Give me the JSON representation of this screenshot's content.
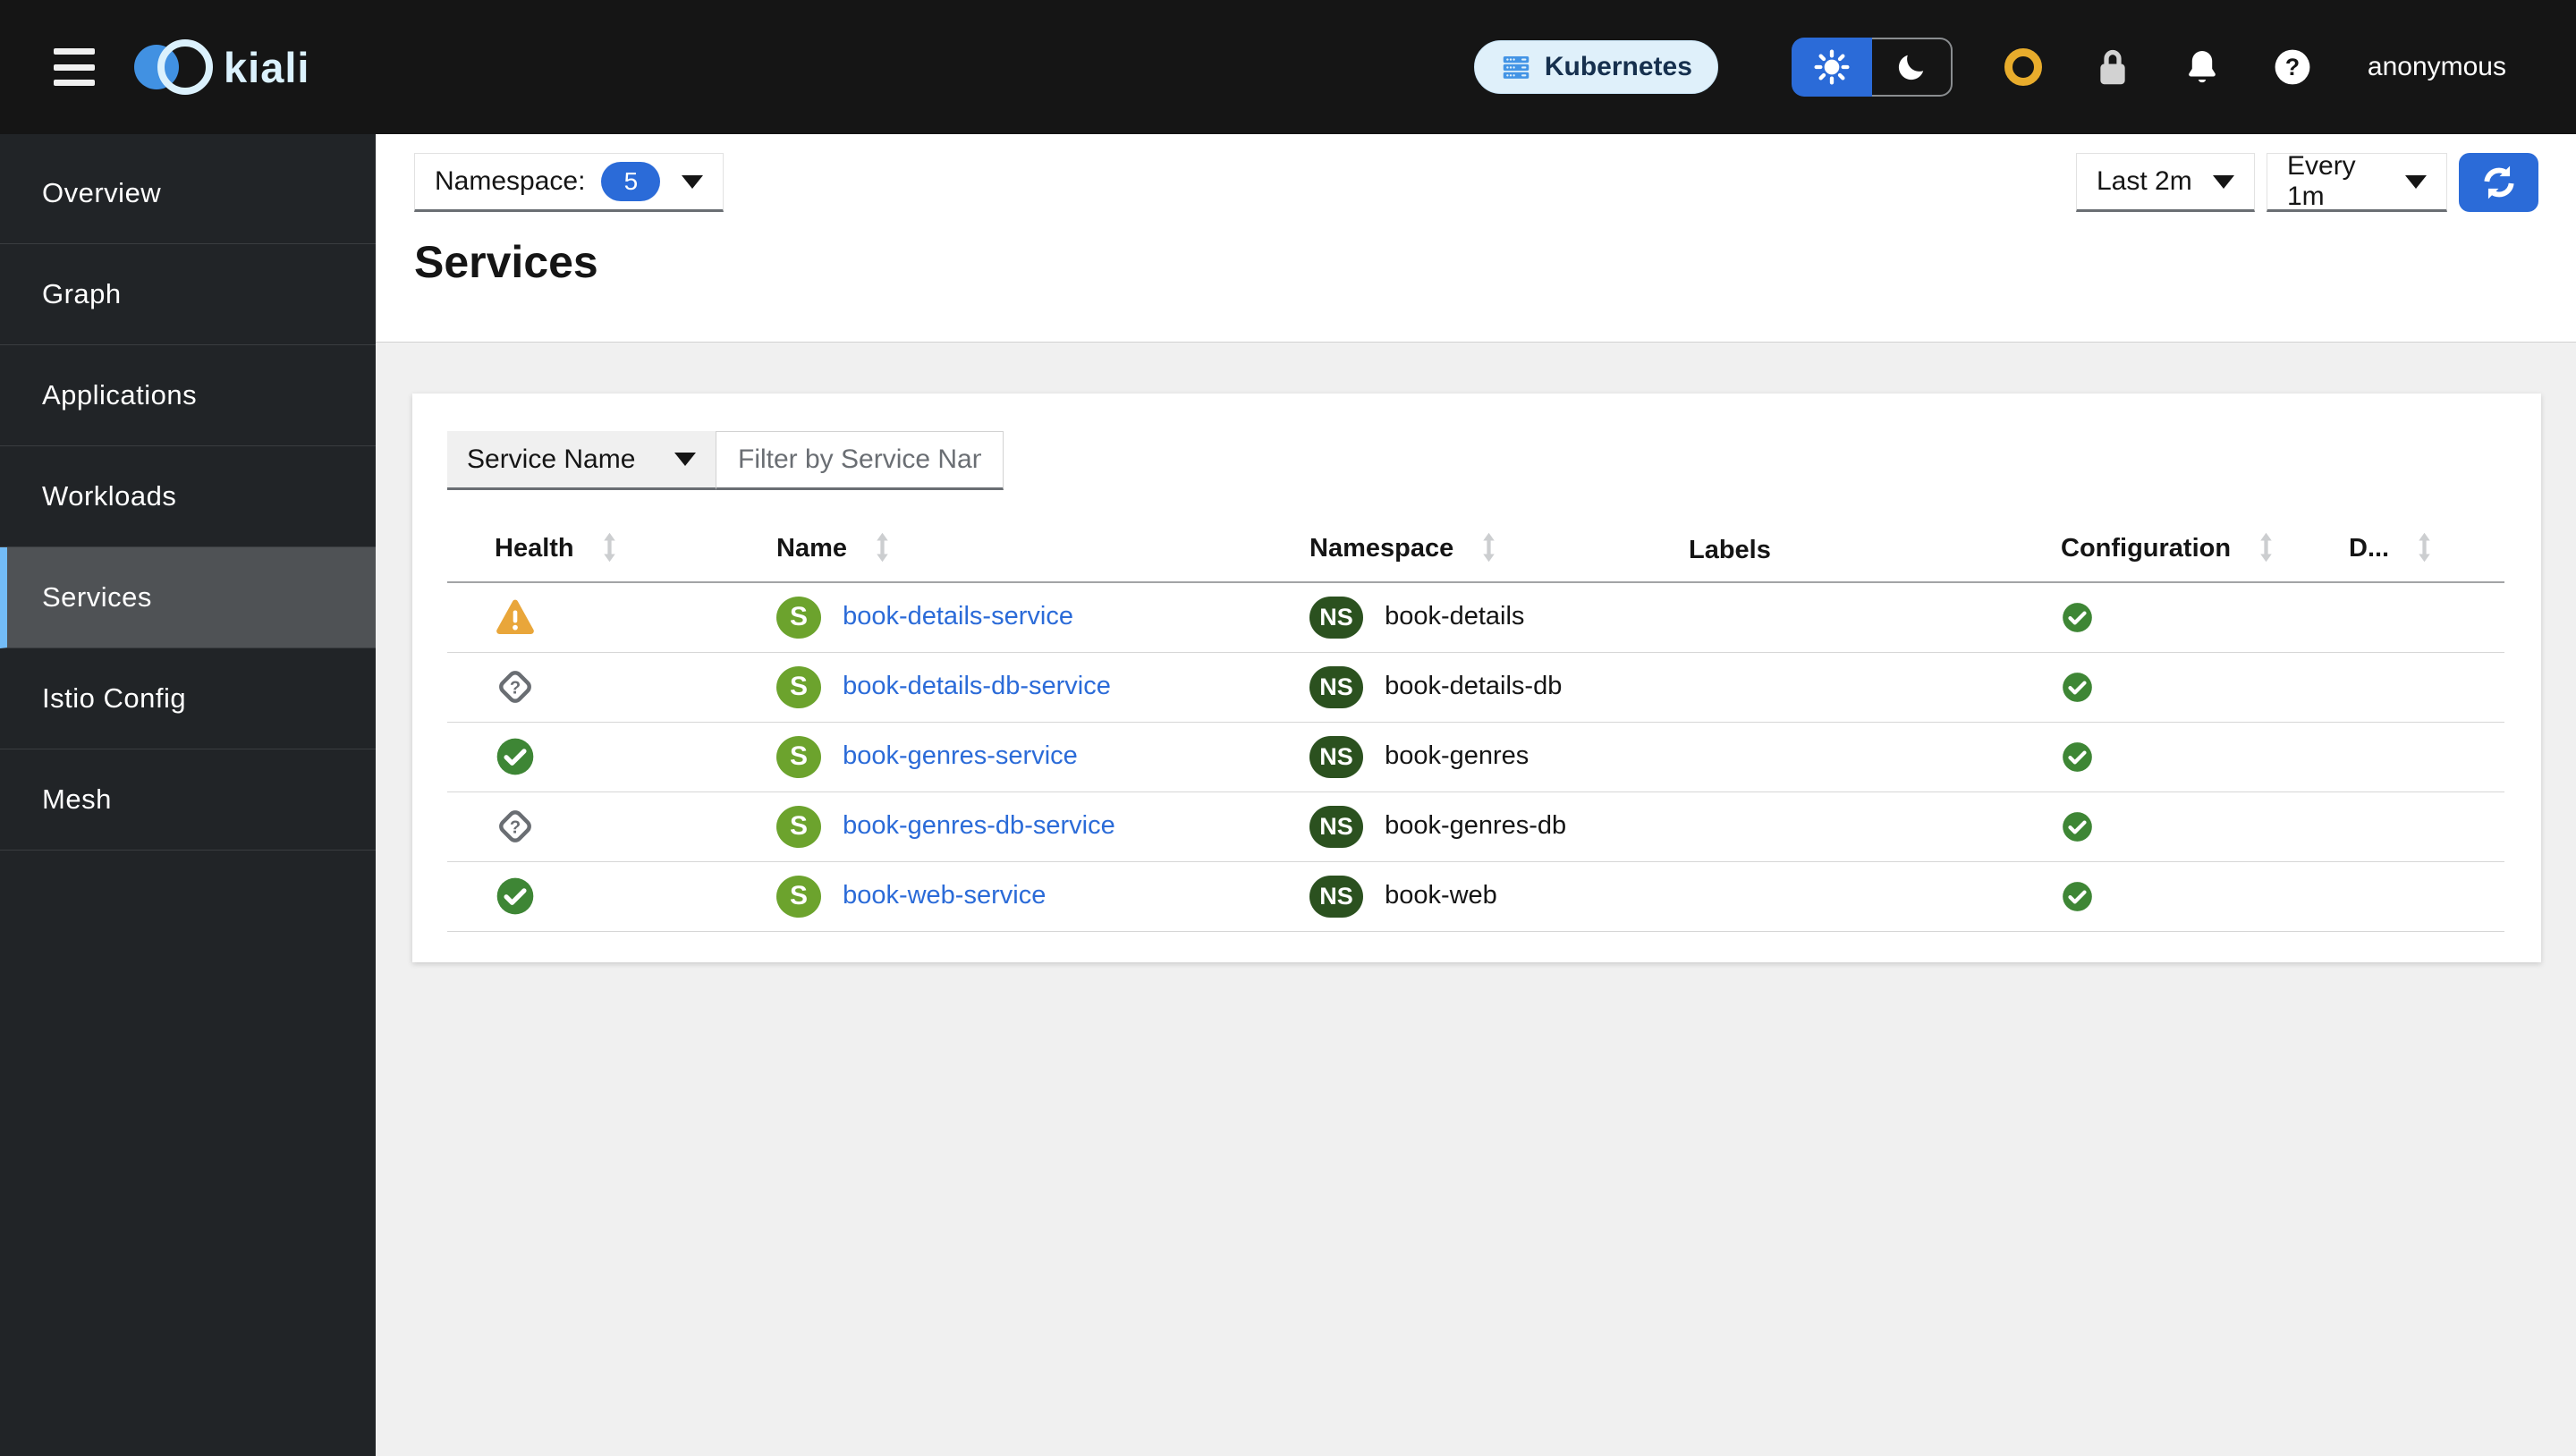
{
  "header": {
    "brand": "kiali",
    "cluster_badge": "Kubernetes",
    "username": "anonymous"
  },
  "sidebar": {
    "active": "Services",
    "items": [
      {
        "label": "Overview"
      },
      {
        "label": "Graph"
      },
      {
        "label": "Applications"
      },
      {
        "label": "Workloads"
      },
      {
        "label": "Services"
      },
      {
        "label": "Istio Config"
      },
      {
        "label": "Mesh"
      }
    ]
  },
  "toolbar": {
    "namespace_label": "Namespace:",
    "namespace_count": "5",
    "time_range": "Last 2m",
    "refresh_interval": "Every 1m"
  },
  "page": {
    "title": "Services"
  },
  "filter": {
    "field_selected": "Service Name",
    "placeholder": "Filter by Service Name"
  },
  "table": {
    "columns": [
      {
        "label": "Health"
      },
      {
        "label": "Name"
      },
      {
        "label": "Namespace"
      },
      {
        "label": "Labels"
      },
      {
        "label": "Configuration"
      },
      {
        "label": "D..."
      }
    ],
    "rows": [
      {
        "health": "warning",
        "service_badge": "S",
        "name": "book-details-service",
        "ns_badge": "NS",
        "namespace": "book-details",
        "configuration": "valid"
      },
      {
        "health": "unknown",
        "service_badge": "S",
        "name": "book-details-db-service",
        "ns_badge": "NS",
        "namespace": "book-details-db",
        "configuration": "valid"
      },
      {
        "health": "healthy",
        "service_badge": "S",
        "name": "book-genres-service",
        "ns_badge": "NS",
        "namespace": "book-genres",
        "configuration": "valid"
      },
      {
        "health": "unknown",
        "service_badge": "S",
        "name": "book-genres-db-service",
        "ns_badge": "NS",
        "namespace": "book-genres-db",
        "configuration": "valid"
      },
      {
        "health": "healthy",
        "service_badge": "S",
        "name": "book-web-service",
        "ns_badge": "NS",
        "namespace": "book-web",
        "configuration": "valid"
      }
    ]
  },
  "colors": {
    "masthead_bg": "#151515",
    "sidebar_bg": "#212427",
    "accent_blue": "#2b6bd8",
    "active_nav_border": "#73bcf7",
    "link_blue": "#2b6bd8",
    "success_green": "#3e8635",
    "warning_orange": "#e9a63a",
    "unknown_gray": "#6a6e73",
    "service_badge_green": "#6ca32d",
    "namespace_badge_green": "#2b511f",
    "istio_status_gold": "#e8ac2c",
    "content_bg": "#f0f0f0"
  }
}
